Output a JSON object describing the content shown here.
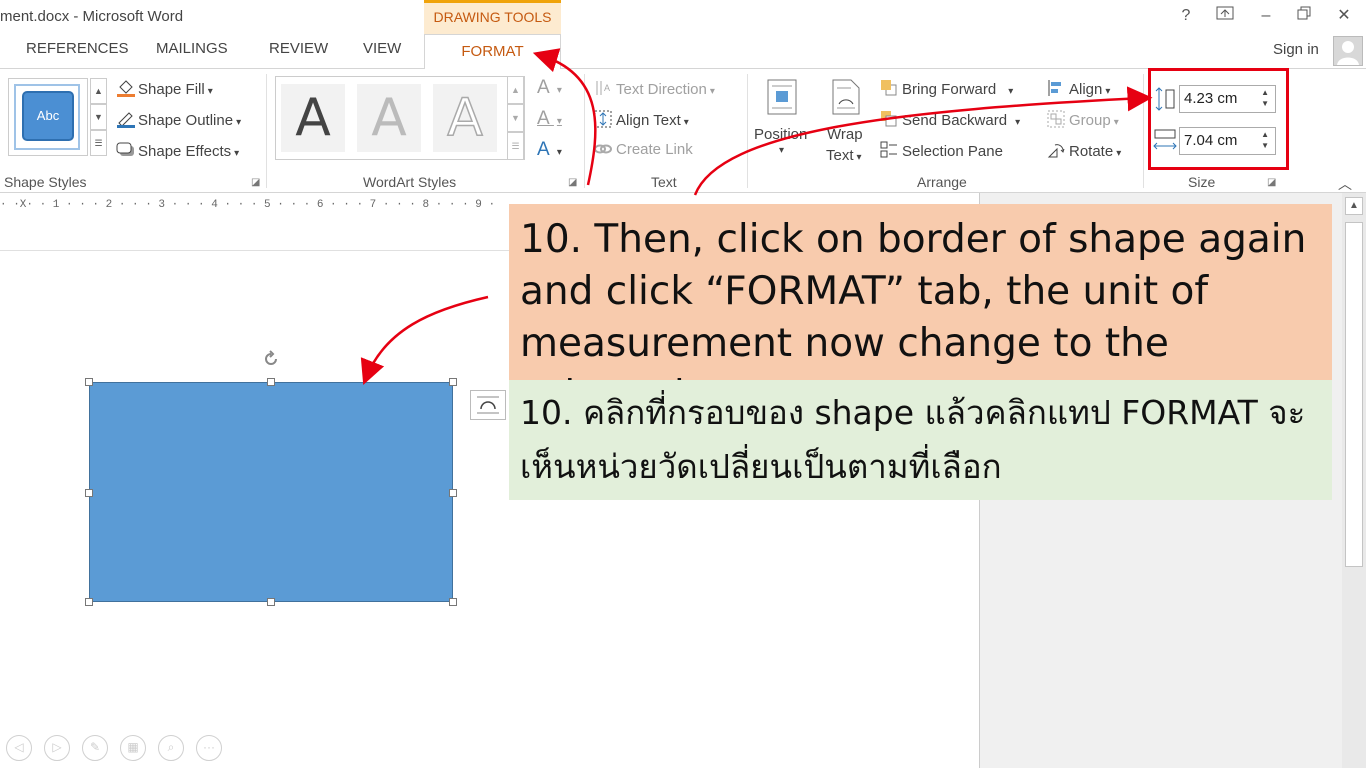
{
  "window": {
    "title": "ment.docx - Microsoft Word",
    "contextual_group": "DRAWING TOOLS",
    "controls": {
      "help": "?",
      "ribbon_options": "⊼",
      "minimize": "–",
      "restore": "🗗",
      "close": "✕"
    }
  },
  "tabs": [
    "REFERENCES",
    "MAILINGS",
    "REVIEW",
    "VIEW",
    "FORMAT"
  ],
  "active_tab": "FORMAT",
  "sign_in": "Sign in",
  "ribbon": {
    "shape_styles": {
      "group_label": "Shape Styles",
      "thumb_text": "Abc",
      "shape_fill": "Shape Fill",
      "shape_outline": "Shape Outline",
      "shape_effects": "Shape Effects"
    },
    "wordart_styles": {
      "group_label": "WordArt Styles",
      "letter": "A"
    },
    "text": {
      "group_label": "Text",
      "text_direction": "Text Direction",
      "align_text": "Align Text",
      "create_link": "Create Link"
    },
    "arrange": {
      "group_label": "Arrange",
      "position": "Position",
      "wrap": "Wrap",
      "wrap_text": "Text",
      "bring_forward": "Bring Forward",
      "send_backward": "Send Backward",
      "selection_pane": "Selection Pane",
      "align": "Align",
      "group": "Group",
      "rotate": "Rotate"
    },
    "size": {
      "group_label": "Size",
      "height": "4.23 cm",
      "width": "7.04 cm"
    }
  },
  "ruler": "· ·X· · 1 · · · 2 · · · 3 · · · 4 · · · 5 · · · 6 · · · 7 · · · 8 · · · 9 ·",
  "callout_en": "10. Then, click on border of shape again and click “FORMAT” tab, the unit of measurement now change to the selected.",
  "callout_th": "10. คลิกที่กรอบของ shape แล้วคลิกแทป FORMAT จะเห็นหน่วยวัดเปลี่ยนเป็นตามที่เลือก",
  "colors": {
    "shape_fill": "#5b9bd5",
    "accent_orange": "#c55a11",
    "highlight_red": "#e60012",
    "callout_en_bg": "#f8cbad",
    "callout_th_bg": "#e2efda"
  },
  "presentation_tools": [
    "prev-icon",
    "next-icon",
    "pen-icon",
    "slides-icon",
    "zoom-icon",
    "more-icon"
  ]
}
